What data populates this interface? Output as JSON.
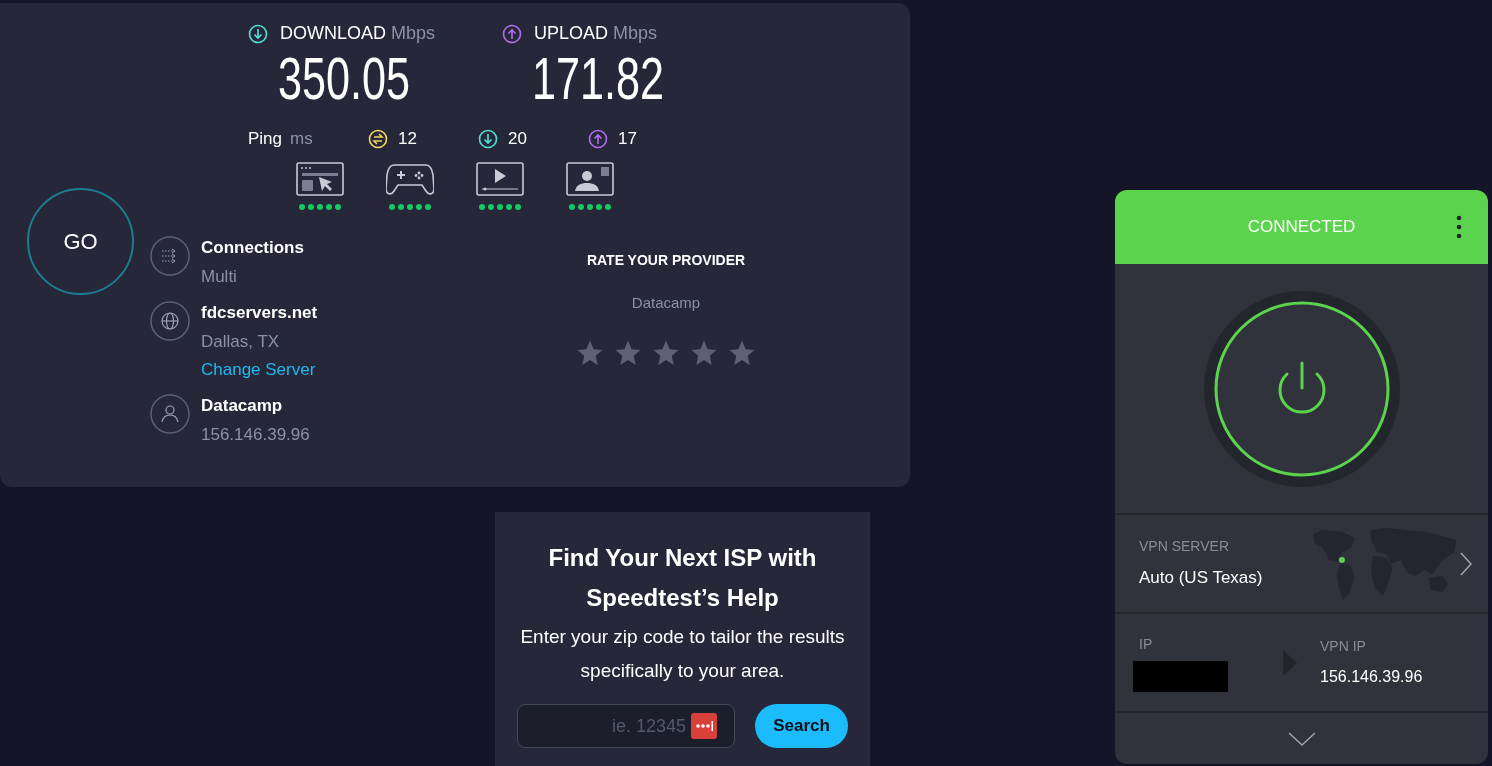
{
  "speedtest": {
    "download": {
      "label": "DOWNLOAD",
      "unit": "Mbps",
      "value": "350.05"
    },
    "upload": {
      "label": "UPLOAD",
      "unit": "Mbps",
      "value": "171.82"
    },
    "ping": {
      "label": "Ping",
      "unit": "ms",
      "values": [
        {
          "kind": "idle",
          "value": "12"
        },
        {
          "kind": "download",
          "value": "20"
        },
        {
          "kind": "upload",
          "value": "17"
        }
      ]
    },
    "go_button": "GO",
    "info": [
      {
        "kind": "connections",
        "title": "Connections",
        "lines": [
          {
            "text": "Multi",
            "link": false
          }
        ]
      },
      {
        "kind": "server",
        "title": "fdcservers.net",
        "lines": [
          {
            "text": "Dallas, TX",
            "link": false
          },
          {
            "text": "Change Server",
            "link": true
          }
        ]
      },
      {
        "kind": "provider",
        "title": "Datacamp",
        "lines": [
          {
            "text": "156.146.39.96",
            "link": false
          }
        ]
      }
    ],
    "rate": {
      "title": "RATE YOUR PROVIDER",
      "provider": "Datacamp",
      "stars": 0
    }
  },
  "isp_promo": {
    "title": "Find Your Next ISP with Speedtest’s Help",
    "text": "Enter your zip code to tailor the results specifically to your area.",
    "zip_field": {
      "placeholder": "ie. 12345"
    },
    "button": "Search"
  },
  "vpn": {
    "status": "CONNECTED",
    "connected": true,
    "server_label": "VPN SERVER",
    "server": "Auto (US Texas)",
    "ip_label": "IP",
    "vpn_ip_label": "VPN IP",
    "vpn_ip": "156.146.39.96"
  }
}
